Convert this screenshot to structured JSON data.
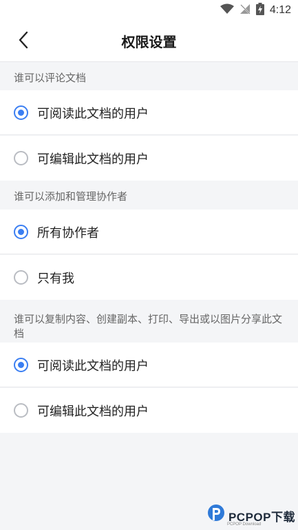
{
  "status_bar": {
    "time": "4:12"
  },
  "nav": {
    "title": "权限设置",
    "back_icon": "chevron-left-icon"
  },
  "sections": [
    {
      "header": "谁可以评论文档",
      "options": [
        {
          "label": "可阅读此文档的用户",
          "selected": true
        },
        {
          "label": "可编辑此文档的用户",
          "selected": false
        }
      ]
    },
    {
      "header": "谁可以添加和管理协作者",
      "options": [
        {
          "label": "所有协作者",
          "selected": true
        },
        {
          "label": "只有我",
          "selected": false
        }
      ]
    },
    {
      "header": "谁可以复制内容、创建副本、打印、导出或以图片分享此文档",
      "options": [
        {
          "label": "可阅读此文档的用户",
          "selected": true
        },
        {
          "label": "可编辑此文档的用户",
          "selected": false
        }
      ]
    }
  ],
  "watermark": {
    "text": "PCPOP下载",
    "sub": "PCPOP Download"
  },
  "colors": {
    "accent": "#3a7ef2",
    "background": "#f4f5f7",
    "card": "#ffffff"
  }
}
